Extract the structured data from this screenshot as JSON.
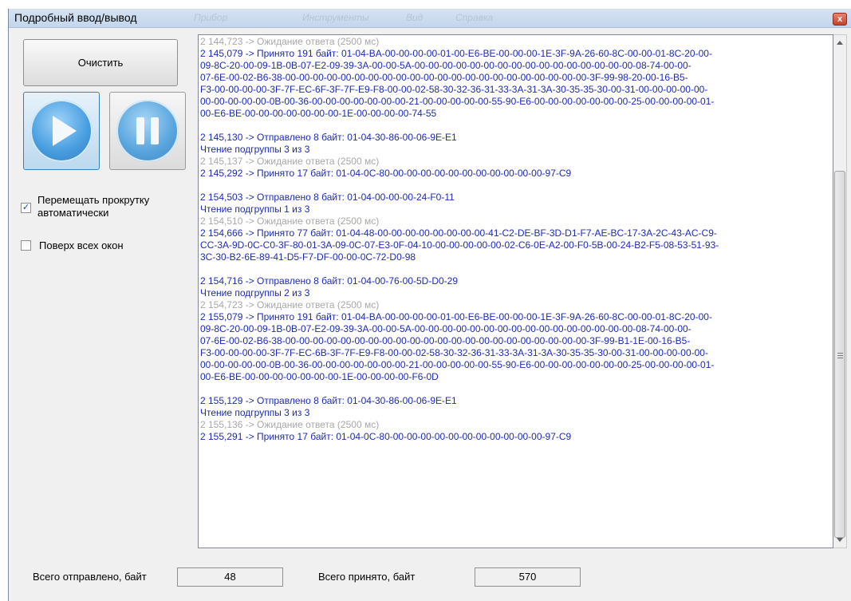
{
  "window": {
    "title": "Подробный ввод/вывод",
    "close_label": "x",
    "background_menu": [
      "Прибор",
      "Инструменты",
      "Вид",
      "Справка"
    ]
  },
  "controls": {
    "clear_label": "Очистить",
    "play_icon": "play-icon",
    "pause_icon": "pause-icon",
    "autoscroll": {
      "label_line1": "Перемещать прокрутку",
      "label_line2": "автоматически",
      "checked": true
    },
    "topmost": {
      "label": "Поверх всех окон",
      "checked": false
    }
  },
  "log_lines": [
    {
      "t": "2 144,723 -> Ожидание ответа (2500 мс)",
      "c": "wait"
    },
    {
      "t": "2 145,079 -> Принято 191 байт: 01-04-BA-00-00-00-00-01-00-E6-BE-00-00-00-1E-3F-9A-26-60-8C-00-00-01-8C-20-00-",
      "c": "blue"
    },
    {
      "t": "09-8C-20-00-09-1B-0B-07-E2-09-39-3A-00-00-5A-00-00-00-00-00-00-00-00-00-00-00-00-00-00-00-00-08-74-00-00-",
      "c": "blue"
    },
    {
      "t": "07-6E-00-02-B6-38-00-00-00-00-00-00-00-00-00-00-00-00-00-00-00-00-00-00-00-00-00-00-3F-99-98-20-00-16-B5-",
      "c": "blue"
    },
    {
      "t": "F3-00-00-00-00-3F-7F-EC-6F-3F-7F-E9-F8-00-00-02-58-30-32-36-31-33-3A-31-3A-30-35-35-30-00-31-00-00-00-00-00-",
      "c": "blue"
    },
    {
      "t": "00-00-00-00-00-0B-00-36-00-00-00-00-00-00-00-21-00-00-00-00-00-55-90-E6-00-00-00-00-00-00-00-25-00-00-00-00-01-",
      "c": "blue"
    },
    {
      "t": "00-E6-BE-00-00-00-00-00-00-00-1E-00-00-00-00-74-55",
      "c": "blue"
    },
    {
      "t": "",
      "c": "blank"
    },
    {
      "t": "2 145,130 -> Отправлено 8 байт: 01-04-30-86-00-06-9E-E1",
      "c": "blue"
    },
    {
      "t": "Чтение подгруппы 3 из 3",
      "c": "blue"
    },
    {
      "t": "2 145,137 -> Ожидание ответа (2500 мс)",
      "c": "wait"
    },
    {
      "t": "2 145,292 -> Принято 17 байт: 01-04-0C-80-00-00-00-00-00-00-00-00-00-00-00-97-C9",
      "c": "blue"
    },
    {
      "t": "",
      "c": "blank"
    },
    {
      "t": "2 154,503 -> Отправлено 8 байт: 01-04-00-00-00-24-F0-11",
      "c": "blue"
    },
    {
      "t": "Чтение подгруппы 1 из 3",
      "c": "blue"
    },
    {
      "t": "2 154,510 -> Ожидание ответа (2500 мс)",
      "c": "wait"
    },
    {
      "t": "2 154,666 -> Принято 77 байт: 01-04-48-00-00-00-00-00-00-00-00-41-C2-DE-BF-3D-D1-F7-AE-BC-17-3A-2C-43-AC-C9-",
      "c": "blue"
    },
    {
      "t": "CC-3A-9D-0C-C0-3F-80-01-3A-09-0C-07-E3-0F-04-10-00-00-00-00-00-02-C6-0E-A2-00-F0-5B-00-24-B2-F5-08-53-51-93-",
      "c": "blue"
    },
    {
      "t": "3C-30-B2-6E-89-41-D5-F7-DF-00-00-0C-72-D0-98",
      "c": "blue"
    },
    {
      "t": "",
      "c": "blank"
    },
    {
      "t": "2 154,716 -> Отправлено 8 байт: 01-04-00-76-00-5D-D0-29",
      "c": "blue"
    },
    {
      "t": "Чтение подгруппы 2 из 3",
      "c": "blue"
    },
    {
      "t": "2 154,723 -> Ожидание ответа (2500 мс)",
      "c": "wait"
    },
    {
      "t": "2 155,079 -> Принято 191 байт: 01-04-BA-00-00-00-00-01-00-E6-BE-00-00-00-1E-3F-9A-26-60-8C-00-00-01-8C-20-00-",
      "c": "blue"
    },
    {
      "t": "09-8C-20-00-09-1B-0B-07-E2-09-39-3A-00-00-5A-00-00-00-00-00-00-00-00-00-00-00-00-00-00-00-00-08-74-00-00-",
      "c": "blue"
    },
    {
      "t": "07-6E-00-02-B6-38-00-00-00-00-00-00-00-00-00-00-00-00-00-00-00-00-00-00-00-00-00-00-3F-99-B1-1E-00-16-B5-",
      "c": "blue"
    },
    {
      "t": "F3-00-00-00-00-3F-7F-EC-6B-3F-7F-E9-F8-00-00-02-58-30-32-36-31-33-3A-31-3A-30-35-35-30-00-31-00-00-00-00-00-",
      "c": "blue"
    },
    {
      "t": "00-00-00-00-00-0B-00-36-00-00-00-00-00-00-00-21-00-00-00-00-00-55-90-E6-00-00-00-00-00-00-00-25-00-00-00-00-01-",
      "c": "blue"
    },
    {
      "t": "00-E6-BE-00-00-00-00-00-00-00-1E-00-00-00-00-F6-0D",
      "c": "blue"
    },
    {
      "t": "",
      "c": "blank"
    },
    {
      "t": "2 155,129 -> Отправлено 8 байт: 01-04-30-86-00-06-9E-E1",
      "c": "blue"
    },
    {
      "t": "Чтение подгруппы 3 из 3",
      "c": "blue"
    },
    {
      "t": "2 155,136 -> Ожидание ответа (2500 мс)",
      "c": "wait"
    },
    {
      "t": "2 155,291 -> Принято 17 байт: 01-04-0C-80-00-00-00-00-00-00-00-00-00-00-00-97-C9",
      "c": "blue"
    }
  ],
  "totals": {
    "sent_label": "Всего отправлено, байт",
    "sent_value": "48",
    "received_label": "Всего принято, байт",
    "received_value": "570"
  },
  "colors": {
    "log_text": "#1c2bb3",
    "log_wait": "#a8a8a8",
    "accent": "#4a9fe0"
  }
}
